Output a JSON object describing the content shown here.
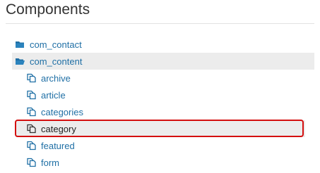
{
  "page": {
    "title": "Components"
  },
  "tree": {
    "items": [
      {
        "label": "com_contact",
        "icon": "folder-closed-icon",
        "level": 0,
        "selected": false
      },
      {
        "label": "com_content",
        "icon": "folder-open-icon",
        "level": 0,
        "selected": true
      },
      {
        "label": "archive",
        "icon": "copy-files-icon",
        "level": 1,
        "selected": false
      },
      {
        "label": "article",
        "icon": "copy-files-icon",
        "level": 1,
        "selected": false
      },
      {
        "label": "categories",
        "icon": "copy-files-icon",
        "level": 1,
        "selected": false
      },
      {
        "label": "category",
        "icon": "copy-files-icon",
        "level": 1,
        "selected": true,
        "highlighted": true
      },
      {
        "label": "featured",
        "icon": "copy-files-icon",
        "level": 1,
        "selected": false
      },
      {
        "label": "form",
        "icon": "copy-files-icon",
        "level": 1,
        "selected": false
      }
    ]
  },
  "colors": {
    "link": "#1f6fa5",
    "selected_row": "#ececec",
    "highlight_border": "#d40f0f"
  }
}
